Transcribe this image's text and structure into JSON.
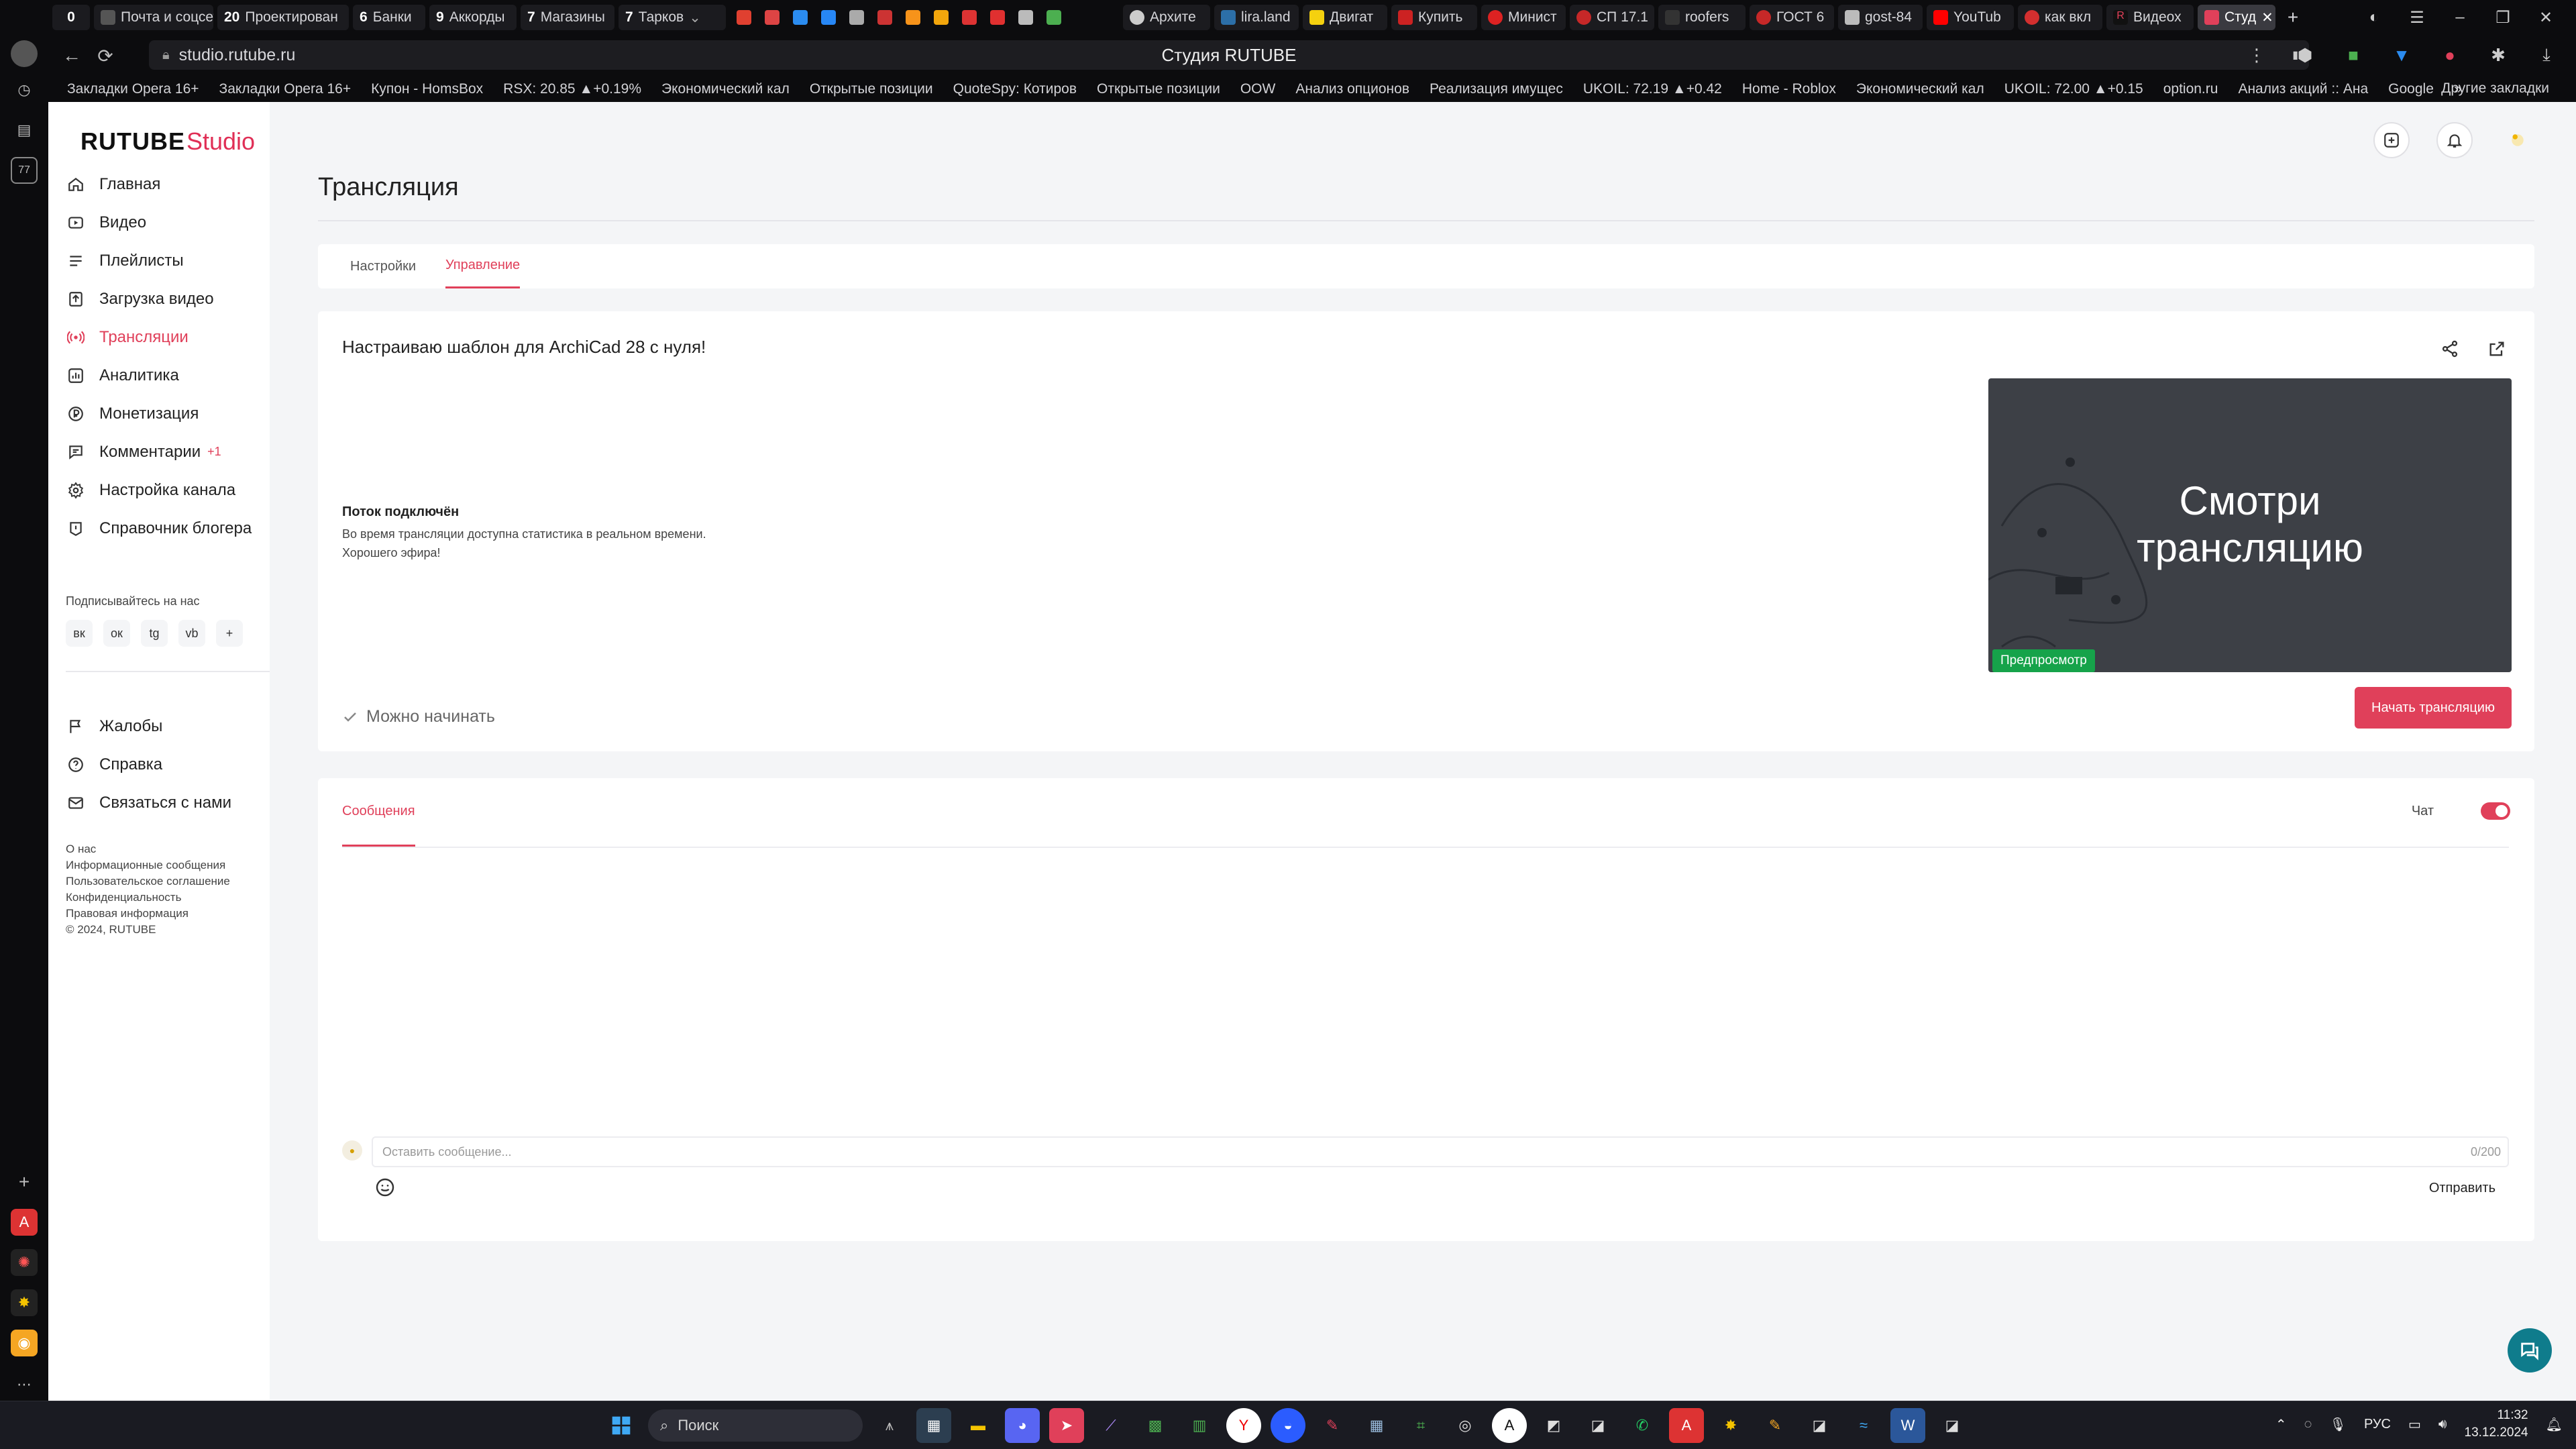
{
  "browser": {
    "tabs": [
      {
        "count": "0",
        "label": ""
      },
      {
        "count": "",
        "label": "Почта и соцсет"
      },
      {
        "count": "20",
        "label": "Проектирован"
      },
      {
        "count": "6",
        "label": "Банки"
      },
      {
        "count": "9",
        "label": "Аккорды"
      },
      {
        "count": "7",
        "label": "Магазины"
      },
      {
        "count": "7",
        "label": "Тарков"
      },
      {
        "count": "",
        "label": "Архите"
      },
      {
        "count": "",
        "label": "lira.land"
      },
      {
        "count": "",
        "label": "Двигат"
      },
      {
        "count": "",
        "label": "Купить"
      },
      {
        "count": "",
        "label": "Минист"
      },
      {
        "count": "",
        "label": "СП 17.1"
      },
      {
        "count": "",
        "label": "roofers"
      },
      {
        "count": "",
        "label": "ГОСТ 6"
      },
      {
        "count": "",
        "label": "gost-84"
      },
      {
        "count": "",
        "label": "YouTub"
      },
      {
        "count": "",
        "label": "как вкл"
      },
      {
        "count": "",
        "label": "Видеох"
      },
      {
        "count": "",
        "label": "Студ"
      }
    ],
    "url": "studio.rutube.ru",
    "page_title": "Студия RUTUBE",
    "bookmarks": [
      "Закладки Opera 16+",
      "Закладки Opera 16+",
      "Купон - HomsBox",
      "RSX: 20.85 ▲+0.19%",
      "Экономический кал",
      "Открытые позиции",
      "QuoteSpy: Котиров",
      "Открытые позиции",
      "OOW",
      "Анализ опционов",
      "Реализация имущес",
      "UKOIL: 72.19 ▲+0.42",
      "Home - Roblox",
      "Экономический кал",
      "UKOIL: 72.00 ▲+0.15",
      "option.ru",
      "Анализ акций :: Ана",
      "Google"
    ],
    "other_bookmarks": "Другие закладки",
    "more": "»"
  },
  "sidebar": {
    "logo_main": "RUTUBE",
    "logo_sub": "Studio",
    "items": [
      {
        "label": "Главная",
        "icon": "home-icon"
      },
      {
        "label": "Видео",
        "icon": "video-icon"
      },
      {
        "label": "Плейлисты",
        "icon": "playlist-icon"
      },
      {
        "label": "Загрузка видео",
        "icon": "upload-icon"
      },
      {
        "label": "Трансляции",
        "icon": "broadcast-icon"
      },
      {
        "label": "Аналитика",
        "icon": "analytics-icon"
      },
      {
        "label": "Монетизация",
        "icon": "monetization-icon"
      },
      {
        "label": "Комментарии",
        "icon": "comments-icon",
        "badge": "+1"
      },
      {
        "label": "Настройка канала",
        "icon": "settings-icon"
      },
      {
        "label": "Справочник блогера",
        "icon": "guide-icon"
      }
    ],
    "subscribe_label": "Подписывайтесь на нас",
    "social": [
      "вк",
      "ок",
      "tg",
      "vb",
      "+"
    ],
    "items2": [
      {
        "label": "Жалобы",
        "icon": "flag-icon"
      },
      {
        "label": "Справка",
        "icon": "help-icon"
      },
      {
        "label": "Связаться с нами",
        "icon": "mail-icon"
      }
    ],
    "footer": [
      "О нас",
      "Информационные сообщения",
      "Пользовательское соглашение",
      "Конфиденциальность",
      "Правовая информация",
      "© 2024, RUTUBE"
    ]
  },
  "main": {
    "title": "Трансляция",
    "tabs": [
      "Настройки",
      "Управление"
    ],
    "stream_title": "Настраиваю шаблон для ArchiCad 28 с нуля!",
    "status_title": "Поток подключён",
    "status_desc_1": "Во время трансляции доступна статистика в реальном времени.",
    "status_desc_2": "Хорошего эфира!",
    "preview_text_1": "Смотри",
    "preview_text_2": "трансляцию",
    "preview_badge": "Предпросмотр",
    "ready_label": "Можно начинать",
    "start_button": "Начать трансляцию"
  },
  "chat": {
    "tab": "Сообщения",
    "toggle_label": "Чат",
    "placeholder": "Оставить сообщение...",
    "counter": "0/200",
    "send": "Отправить"
  },
  "taskbar": {
    "search": "Поиск",
    "lang": "РУС",
    "time": "11:32",
    "date": "13.12.2024"
  },
  "colors": {
    "accent": "#e0405a",
    "badge_green": "#16a34a"
  }
}
